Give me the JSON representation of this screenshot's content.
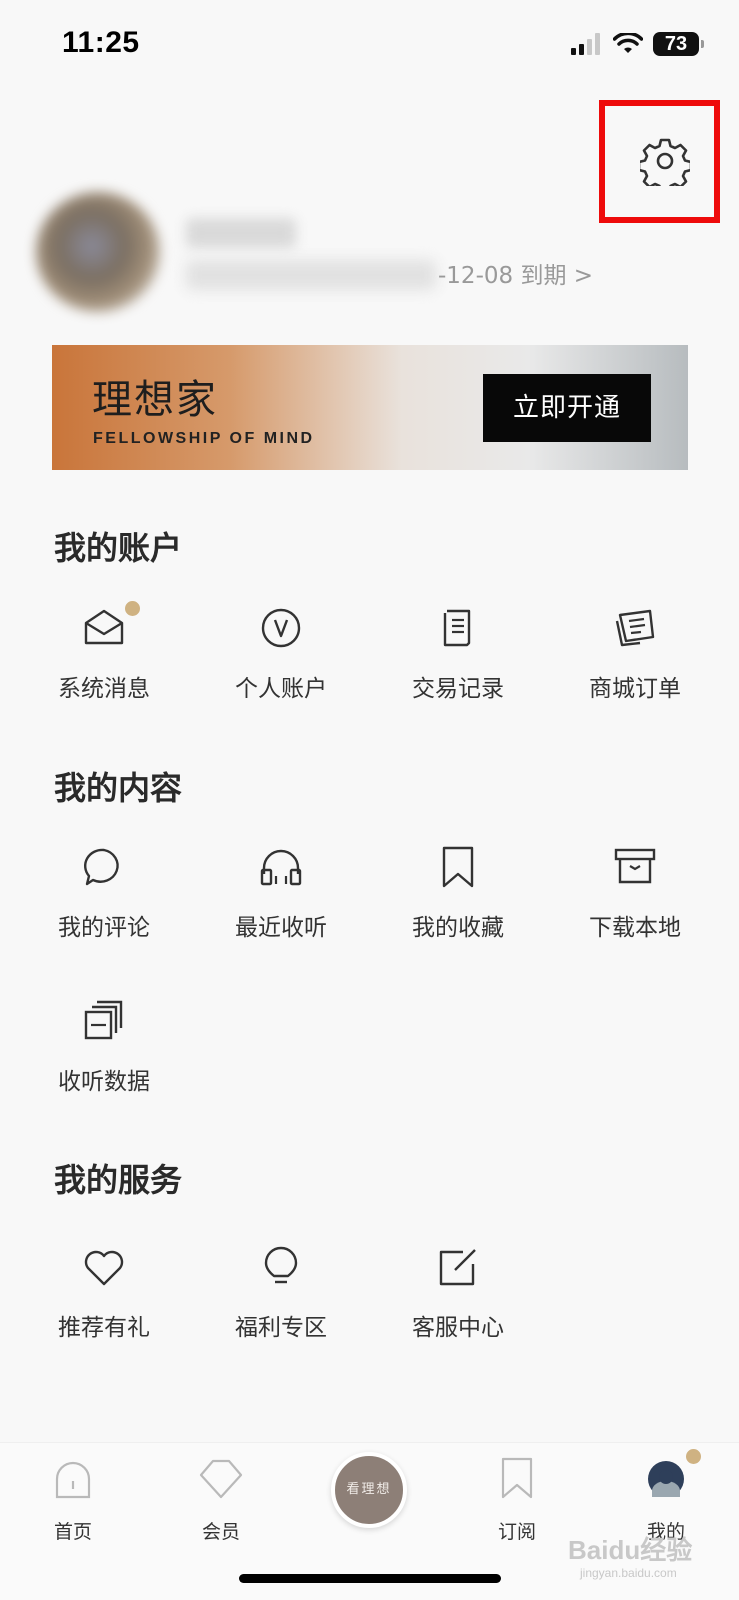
{
  "status_bar": {
    "time": "11:25",
    "battery": "73"
  },
  "profile": {
    "expiry_text": "-12-08 到期 >"
  },
  "banner": {
    "title": "理想家",
    "subtitle": "FELLOWSHIP OF MIND",
    "button_label": "立即开通"
  },
  "sections": {
    "account": {
      "title": "我的账户",
      "items": [
        {
          "label": "系统消息",
          "icon": "mail-open-icon",
          "has_dot": true
        },
        {
          "label": "个人账户",
          "icon": "v-circle-icon"
        },
        {
          "label": "交易记录",
          "icon": "receipt-icon"
        },
        {
          "label": "商城订单",
          "icon": "order-list-icon"
        }
      ]
    },
    "content": {
      "title": "我的内容",
      "items": [
        {
          "label": "我的评论",
          "icon": "comment-icon"
        },
        {
          "label": "最近收听",
          "icon": "headphones-icon"
        },
        {
          "label": "我的收藏",
          "icon": "bookmark-icon"
        },
        {
          "label": "下载本地",
          "icon": "archive-box-icon"
        },
        {
          "label": "收听数据",
          "icon": "stacked-pages-icon"
        }
      ]
    },
    "service": {
      "title": "我的服务",
      "items": [
        {
          "label": "推荐有礼",
          "icon": "heart-icon"
        },
        {
          "label": "福利专区",
          "icon": "lightbulb-icon"
        },
        {
          "label": "客服中心",
          "icon": "edit-square-icon"
        }
      ]
    }
  },
  "tabbar": {
    "home": "首页",
    "member": "会员",
    "center": "看理想",
    "subscribe": "订阅",
    "mine": "我的"
  },
  "watermark": {
    "main": "Baidu经验",
    "sub": "jingyan.baidu.com"
  },
  "colors": {
    "accent_dot": "#cfb282",
    "highlight": "#ee0b0b",
    "center_button": "#8d7f77"
  }
}
